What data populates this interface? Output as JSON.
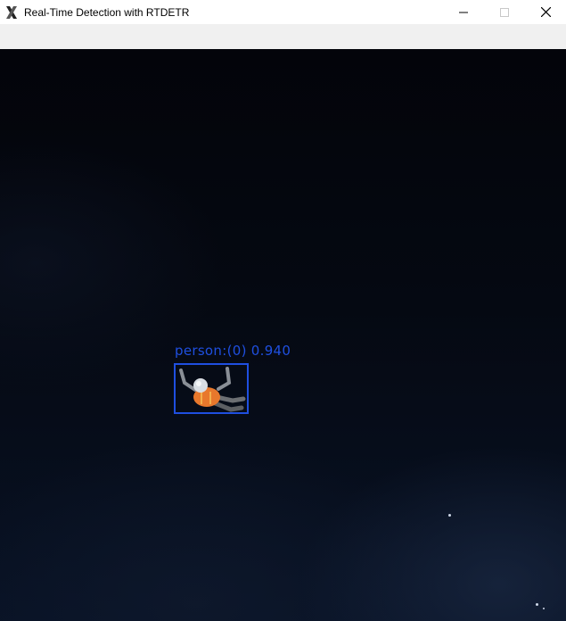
{
  "window": {
    "title": "Real-Time Detection with RTDETR",
    "icons": {
      "app": "x-window-icon",
      "minimize": "minimize-icon",
      "maximize": "maximize-icon",
      "close": "close-icon"
    }
  },
  "detection": {
    "label": "person:(0)  0.940",
    "class_name": "person",
    "class_id": 0,
    "confidence": 0.94,
    "box_color": "#1f4fe0"
  },
  "colors": {
    "frame_background": "#03040a",
    "toolbar": "#f0f0f0",
    "titlebar": "#ffffff"
  }
}
